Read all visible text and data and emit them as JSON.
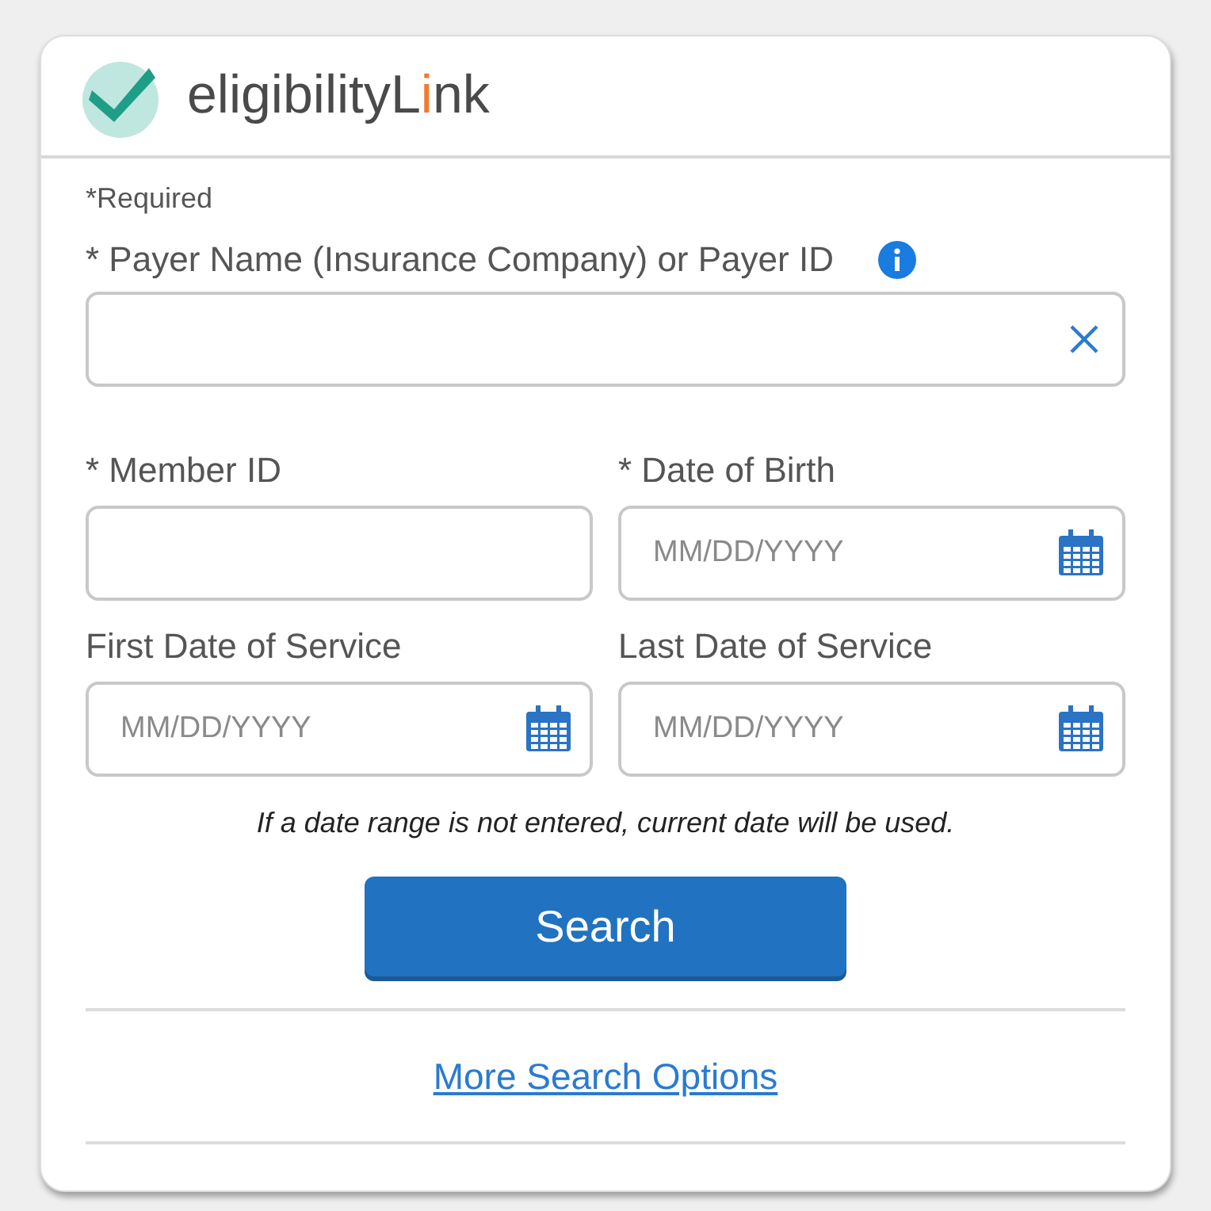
{
  "logo": {
    "parts": [
      {
        "text": "eligibilityL",
        "color": "#4a4a4a"
      },
      {
        "text": "i",
        "color": "#f07a30"
      },
      {
        "text": "nk",
        "color": "#4a4a4a"
      }
    ]
  },
  "required_note": "*Required",
  "payer": {
    "label": "* Payer Name (Insurance Company) or Payer ID"
  },
  "fields": [
    {
      "label": "* Member ID",
      "kind": "text"
    },
    {
      "label": "* Date of Birth",
      "placeholder": "MM/DD/YYYY",
      "kind": "date"
    },
    {
      "label": "First Date of Service",
      "placeholder": "MM/DD/YYYY",
      "kind": "date"
    },
    {
      "label": "Last Date of Service",
      "placeholder": "MM/DD/YYYY",
      "kind": "date"
    }
  ],
  "hint": "If a date range is not entered, current date will be used.",
  "search_button": "Search",
  "more_link": "More Search Options"
}
